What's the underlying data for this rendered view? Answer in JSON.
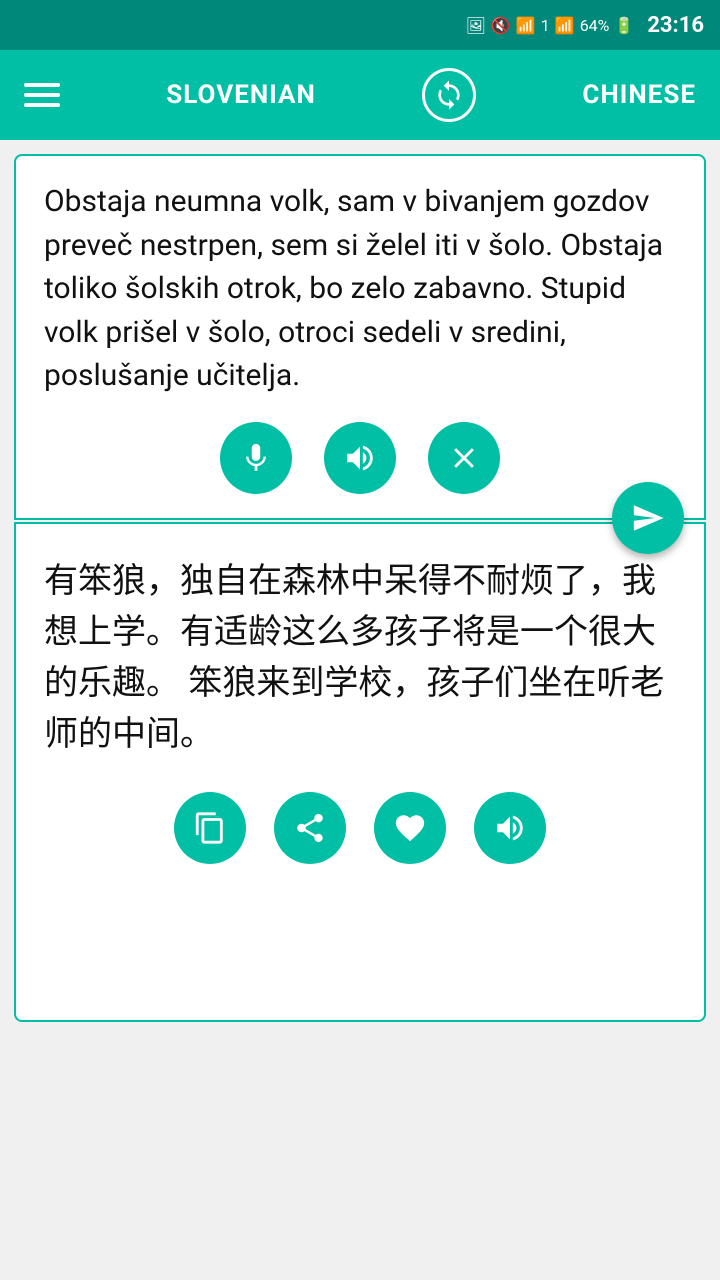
{
  "statusBar": {
    "time": "23:16",
    "battery": "64%"
  },
  "navBar": {
    "menuLabel": "☰",
    "sourceLang": "SLOVENIAN",
    "targetLang": "CHINESE",
    "swapIcon": "↻"
  },
  "sourceBox": {
    "text": "Obstaja neumna volk, sam v bivanjem gozdov preveč nestrpen, sem si želel iti v šolo. Obstaja toliko šolskih otrok, bo zelo zabavno.\nStupid volk prišel v šolo, otroci sedeli v sredini, poslušanje učitelja.",
    "micLabel": "🎤",
    "speakerLabel": "🔊",
    "clearLabel": "✕",
    "sendLabel": "➤"
  },
  "targetBox": {
    "text": "有笨狼，独自在森林中呆得不耐烦了，我想上学。有适龄这么多孩子将是一个很大的乐趣。\n笨狼来到学校，孩子们坐在听老师的中间。",
    "copyLabel": "⧉",
    "shareLabel": "⇗",
    "heartLabel": "♥",
    "speakerLabel": "🔊"
  }
}
